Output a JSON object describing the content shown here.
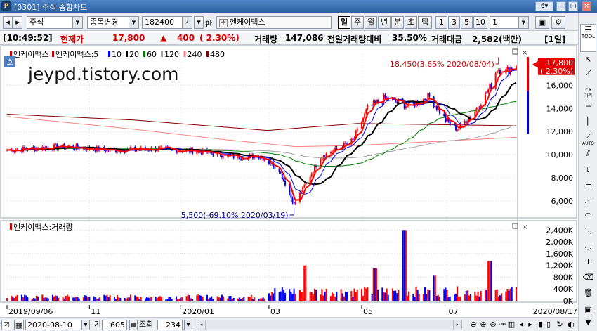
{
  "titlebar": {
    "title": "[0301] 주식 종합차트",
    "logo": "P",
    "page_num": "6",
    "min": "–",
    "max": "□",
    "close": "×"
  },
  "toolbar": {
    "market": "주식",
    "code_change": "종목변경",
    "code": "182400",
    "pan_label": "판",
    "stock_name": "엔케이맥스",
    "periods": [
      "일",
      "주",
      "월",
      "년",
      "분",
      "초",
      "틱"
    ],
    "active_period": "일",
    "numbers": [
      "1",
      "3",
      "5",
      "10"
    ],
    "count": "1"
  },
  "info": {
    "time": "[10:49:52]",
    "price_label": "현재가",
    "price": "17,800",
    "arrow": "▲",
    "change": "400",
    "change_pct": "( 2.30%)",
    "volume_label": "거래량",
    "volume": "147,086",
    "vol_ratio_label": "전일거래량대비",
    "vol_ratio": "35.50%",
    "amount_label": "거래대금",
    "amount": "2,582(백만)",
    "range": "[1일]"
  },
  "price_legend": [
    "엔케이맥스",
    "엔케이맥스:5",
    "10",
    "20",
    "60",
    "120",
    "240",
    "480"
  ],
  "volume_legend": "엔케이맥스:거래량",
  "hoga": "호",
  "watermark": "jeypd.tistory.com",
  "colors": {
    "up": "#ff0000",
    "down": "#0000ff",
    "ma5": "#ff0000",
    "ma10": "#0000ff",
    "ma20": "#000000",
    "ma60": "#008000",
    "ma120": "#a0a0a0",
    "ma240": "#ff8080",
    "ma480": "#800000"
  },
  "chart_data": {
    "type": "line",
    "price_axis_labels": [
      "16,000",
      "14,000",
      "12,000",
      "10,000",
      "8,000",
      "6,000"
    ],
    "price_axis_values": [
      16000,
      14000,
      12000,
      10000,
      8000,
      6000
    ],
    "ylim": [
      4600,
      19000
    ],
    "volume_axis_labels": [
      "2,400K",
      "2,000K",
      "1,600K",
      "1,200K",
      "800K",
      "400K",
      "0K"
    ],
    "volume_axis_values": [
      2400000,
      2000000,
      1600000,
      1200000,
      800000,
      400000,
      0
    ],
    "date_labels": [
      "2019/09/06",
      "11",
      "2020/01",
      "03",
      "05",
      "07",
      "2020/08/17"
    ],
    "max_annotation": "18,450(3.65% 2020/08/04)",
    "min_annotation": "5,500(-69.10% 2020/03/19)",
    "current_price": "17,800",
    "current_pct": "( 2.30%)",
    "price_keypoints": [
      {
        "date": "2019-09-06",
        "close": 10400
      },
      {
        "date": "2019-10-15",
        "close": 10700
      },
      {
        "date": "2019-11-15",
        "close": 10400
      },
      {
        "date": "2019-12-15",
        "close": 10500
      },
      {
        "date": "2020-01-15",
        "close": 10300
      },
      {
        "date": "2020-02-10",
        "close": 9800
      },
      {
        "date": "2020-02-25",
        "close": 9900
      },
      {
        "date": "2020-03-09",
        "close": 8700
      },
      {
        "date": "2020-03-19",
        "close": 5700
      },
      {
        "date": "2020-04-06",
        "close": 9800
      },
      {
        "date": "2020-04-28",
        "close": 11200
      },
      {
        "date": "2020-05-08",
        "close": 14000
      },
      {
        "date": "2020-05-20",
        "close": 14900
      },
      {
        "date": "2020-06-05",
        "close": 14200
      },
      {
        "date": "2020-06-19",
        "close": 15000
      },
      {
        "date": "2020-06-30",
        "close": 13000
      },
      {
        "date": "2020-07-08",
        "close": 12200
      },
      {
        "date": "2020-07-20",
        "close": 13800
      },
      {
        "date": "2020-07-31",
        "close": 16000
      },
      {
        "date": "2020-08-04",
        "close": 17500
      },
      {
        "date": "2020-08-10",
        "close": 17200
      },
      {
        "date": "2020-08-17",
        "close": 17800
      }
    ],
    "volume_spikes": [
      {
        "date": "2020-03-27",
        "value": 1200000
      },
      {
        "date": "2020-05-13",
        "value": 1100000
      },
      {
        "date": "2020-06-02",
        "value": 2400000
      },
      {
        "date": "2020-06-22",
        "value": 850000
      },
      {
        "date": "2020-07-30",
        "value": 1350000
      }
    ],
    "grid": true,
    "legend": "top-left"
  },
  "bottombar": {
    "date": "2020-08-10",
    "period_label": "기간",
    "period": "605",
    "view_label": "조회",
    "view": "234"
  }
}
